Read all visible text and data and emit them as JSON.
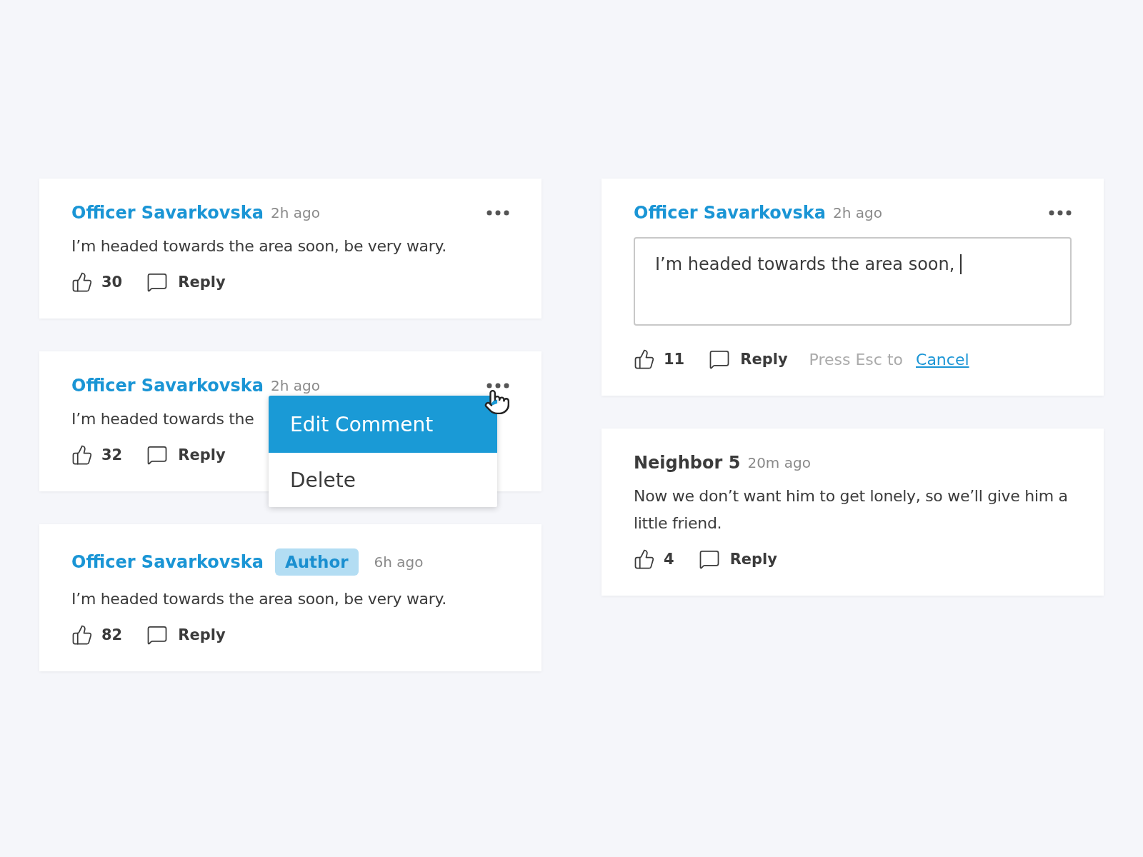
{
  "columns": [
    {
      "comments": [
        {
          "kind": "officer",
          "author": "Officer Savarkovska",
          "time": "2h ago",
          "has_menu": true,
          "body": "I’m headed towards the area soon, be very wary.",
          "likes": "30",
          "reply": "Reply"
        },
        {
          "kind": "officer",
          "author": "Officer Savarkovska",
          "time": "2h ago",
          "has_menu": true,
          "body": "I’m headed towards the",
          "likes": "32",
          "reply": "Reply",
          "menu": {
            "items": [
              {
                "label": "Edit Comment",
                "selected": true
              },
              {
                "label": "Delete",
                "selected": false
              }
            ]
          }
        },
        {
          "kind": "officer",
          "author": "Officer Savarkovska",
          "badge": "Author",
          "time": "6h ago",
          "has_menu": false,
          "body": "I’m headed towards the area soon, be very wary.",
          "likes": "82",
          "reply": "Reply"
        }
      ]
    },
    {
      "comments": [
        {
          "kind": "officer",
          "author": "Officer Savarkovska",
          "time": "2h ago",
          "has_menu": true,
          "edit_value": "I’m headed towards the area soon,",
          "likes": "11",
          "reply": "Reply",
          "hint": {
            "text": "Press Esc to",
            "link": "Cancel"
          }
        },
        {
          "kind": "neighbor",
          "author": "Neighbor 5",
          "time": "20m ago",
          "has_menu": false,
          "body": "Now we don’t want him to get lonely, so we’ll give him a little friend.",
          "likes": "4",
          "reply": "Reply"
        }
      ]
    }
  ]
}
